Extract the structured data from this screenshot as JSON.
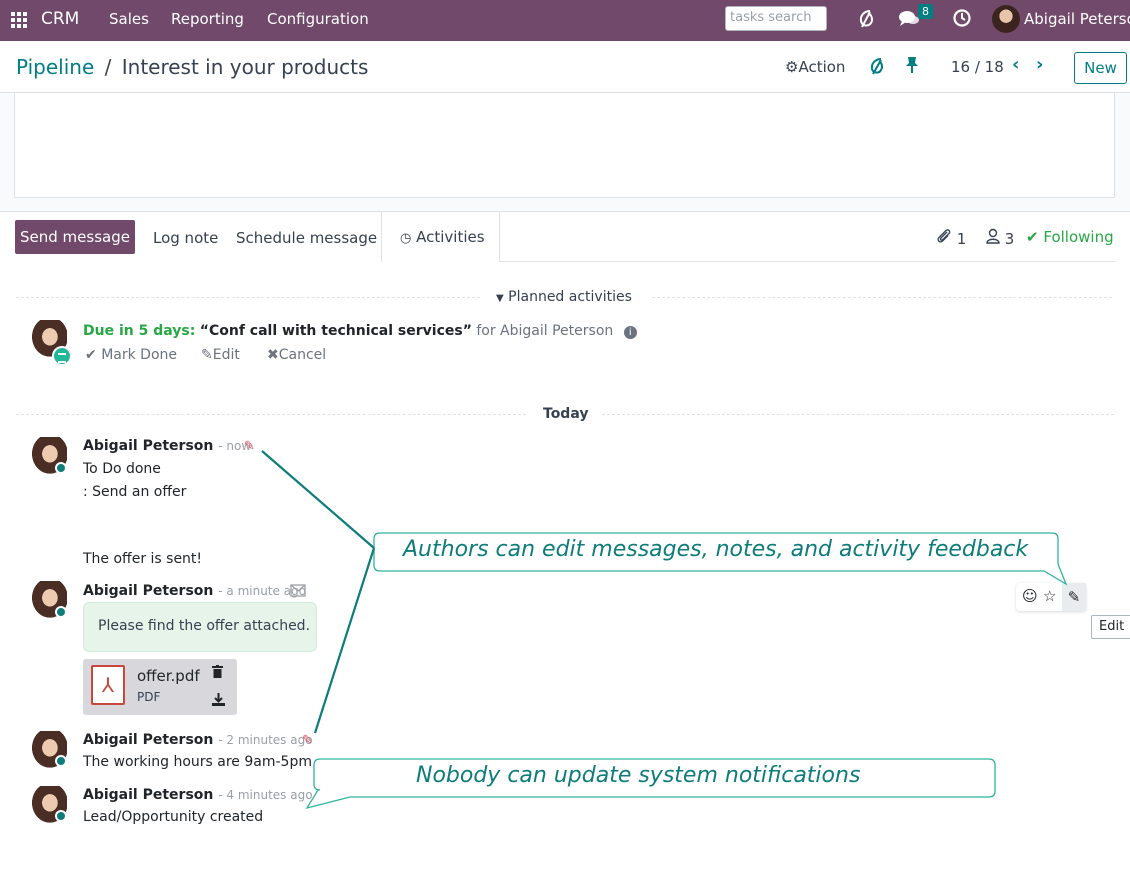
{
  "navbar": {
    "app": "CRM",
    "menu": [
      "Sales",
      "Reporting",
      "Configuration"
    ],
    "search_placeholder": "tasks search",
    "messages_count": "8",
    "user": "Abigail Peterson"
  },
  "control_panel": {
    "breadcrumb_parent": "Pipeline",
    "breadcrumb_sep": "/",
    "breadcrumb_current": "Interest in your products",
    "action_label": "Action",
    "pager": "16 / 18",
    "new_label": "New"
  },
  "chatter": {
    "send_message": "Send message",
    "log_note": "Log note",
    "schedule_message": "Schedule message",
    "activities": "Activities",
    "attachments_count": "1",
    "followers_count": "3",
    "following": "Following",
    "planned_activities": "Planned activities",
    "activity": {
      "due": "Due in 5 days:",
      "summary": "“Conf call with technical services”",
      "for": "for Abigail Peterson",
      "mark_done": "Mark Done",
      "edit": "Edit",
      "cancel": "Cancel"
    },
    "today": "Today",
    "messages": [
      {
        "author": "Abigail Peterson",
        "when": "- now",
        "lines": [
          "To Do done",
          ": Send an offer",
          "The offer is sent!"
        ]
      },
      {
        "author": "Abigail Peterson",
        "when": "- a minute ago",
        "body": "Please find the offer attached.",
        "attachment": {
          "name": "offer.pdf",
          "type": "PDF"
        }
      },
      {
        "author": "Abigail Peterson",
        "when": "- 2 minutes ago",
        "body": "The working hours are 9am-5pm"
      },
      {
        "author": "Abigail Peterson",
        "when": "- 4 minutes ago",
        "body": "Lead/Opportunity created"
      }
    ],
    "tooltip": "Edit"
  },
  "callouts": {
    "edit": "Authors can edit messages, notes, and activity feedback",
    "system": "Nobody can update system notifications"
  },
  "colors": {
    "brand": "#71496a",
    "accent": "#017e84",
    "success": "#28a745",
    "callout": "#0e7c7b"
  },
  "icons": [
    "apps-grid-icon",
    "activity-icon",
    "chat-icon",
    "clock-icon",
    "gear-icon",
    "refresh-icon",
    "pin-icon",
    "paperclip-icon",
    "followers-icon",
    "check-icon",
    "info-icon",
    "pencil-icon",
    "envelope-icon",
    "trash-icon",
    "download-icon",
    "smiley-icon",
    "star-icon",
    "pdf-icon"
  ]
}
